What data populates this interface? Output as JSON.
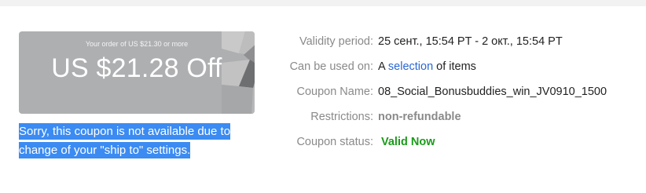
{
  "coupon": {
    "min_order": "Your order of US $21.30 or more",
    "amount": "US $21.28 Off",
    "card_color": "#aeafb1"
  },
  "warning": {
    "line1": "Sorry, this coupon is not available due to",
    "line2": "change of your \"ship to\" settings.",
    "highlight_color": "#3b8bf2"
  },
  "details": {
    "validity_label": "Validity period:",
    "validity_value": "25 сент., 15:54 PT - 2 окт., 15:54 PT",
    "usable_label": "Can be used on:",
    "usable_prefix": "A",
    "usable_link": "selection",
    "usable_suffix": "of items",
    "name_label": "Coupon Name:",
    "name_value": "08_Social_Bonusbuddies_win_JV0910_1500",
    "restrictions_label": "Restrictions:",
    "restrictions_value": "non-refundable",
    "status_label": "Coupon status:",
    "status_value": "Valid Now",
    "status_color": "#1a9b1a",
    "link_color": "#2a67d3"
  }
}
